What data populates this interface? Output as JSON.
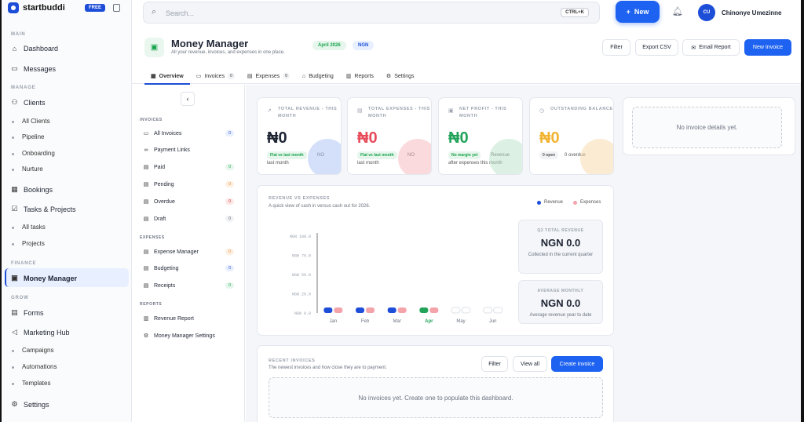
{
  "brand": {
    "name": "startbuddi",
    "plan_badge": "FREE"
  },
  "search": {
    "placeholder": "Search...",
    "shortcut": "CTRL+K"
  },
  "topbar": {
    "new_label": "New",
    "user_initials": "CU",
    "user_name": "Chinonye Umezinne"
  },
  "sidebar": {
    "sections": {
      "main": "MAIN",
      "manage": "MANAGE",
      "finance": "FINANCE",
      "grow": "GROW"
    },
    "items": {
      "dashboard": "Dashboard",
      "messages": "Messages",
      "clients": "Clients",
      "all_clients": "All Clients",
      "pipeline": "Pipeline",
      "onboarding": "Onboarding",
      "nurture": "Nurture",
      "bookings": "Bookings",
      "tasks_projects": "Tasks & Projects",
      "all_tasks": "All tasks",
      "projects": "Projects",
      "money_manager": "Money Manager",
      "forms": "Forms",
      "marketing_hub": "Marketing Hub",
      "campaigns": "Campaigns",
      "automations": "Automations",
      "templates": "Templates",
      "settings": "Settings"
    }
  },
  "header": {
    "title": "Money Manager",
    "subtitle": "All your revenue, invoices, and expenses in one place.",
    "month_badge": "April 2026",
    "currency_badge": "NGN",
    "buttons": {
      "filter": "Filter",
      "export": "Export CSV",
      "email": "Email Report",
      "new_invoice": "New Invoice"
    },
    "tabs": [
      {
        "label": "Overview"
      },
      {
        "label": "Invoices",
        "count": "0"
      },
      {
        "label": "Expenses",
        "count": "0"
      },
      {
        "label": "Budgeting"
      },
      {
        "label": "Reports"
      },
      {
        "label": "Settings"
      }
    ]
  },
  "subnav": {
    "sections": {
      "invoices": "INVOICES",
      "expenses": "EXPENSES",
      "reports": "REPORTS"
    },
    "items": {
      "all_invoices": {
        "label": "All Invoices",
        "count": "0"
      },
      "payment_links": {
        "label": "Payment Links"
      },
      "paid": {
        "label": "Paid",
        "count": "0"
      },
      "pending": {
        "label": "Pending",
        "count": "0"
      },
      "overdue": {
        "label": "Overdue",
        "count": "0"
      },
      "draft": {
        "label": "Draft",
        "count": "0"
      },
      "expense_manager": {
        "label": "Expense Manager",
        "count": "0"
      },
      "budgeting": {
        "label": "Budgeting",
        "count": "0"
      },
      "receipts": {
        "label": "Receipts",
        "count": "0"
      },
      "revenue_report": {
        "label": "Revenue Report"
      },
      "mm_settings": {
        "label": "Money Manager Settings"
      }
    }
  },
  "kpis": {
    "revenue": {
      "label": "TOTAL REVENUE - THIS MONTH",
      "value": "₦0",
      "chip": "Flat vs last month",
      "chip_extra": "NO",
      "sub": "last month"
    },
    "expenses": {
      "label": "TOTAL EXPENSES - THIS MONTH",
      "value": "₦0",
      "chip": "Flat vs last month",
      "chip_extra": "NO",
      "sub": "last month"
    },
    "profit": {
      "label": "NET PROFIT - THIS MONTH",
      "value": "₦0",
      "chip": "No margin yet",
      "chip_extra": "Revenue",
      "sub": "after expenses this month"
    },
    "balance": {
      "label": "OUTSTANDING BALANCE",
      "value": "₦0",
      "chip": "0 open",
      "chip_extra": "0 overdue"
    }
  },
  "invoice_details": {
    "empty": "No invoice details yet."
  },
  "chart_card": {
    "title": "REVENUE VS EXPENSES",
    "subtitle": "A quick view of cash in versus cash out for 2026.",
    "q2": {
      "title": "Q2 TOTAL REVENUE",
      "value": "NGN 0.0",
      "desc": "Collected in the current quarter"
    },
    "avg": {
      "title": "AVERAGE MONTHLY",
      "value": "NGN 0.0",
      "desc": "Average revenue year to date"
    }
  },
  "chart_data": {
    "type": "bar",
    "categories": [
      "Jan",
      "Feb",
      "Mar",
      "Apr",
      "May",
      "Jun"
    ],
    "series": [
      {
        "name": "Revenue",
        "values": [
          0,
          0,
          0,
          0,
          0,
          0
        ]
      },
      {
        "name": "Expenses",
        "values": [
          0,
          0,
          0,
          0,
          0,
          0
        ]
      }
    ],
    "y_ticks": [
      "NGN 100.0",
      "NGN 75.0",
      "NGN 50.0",
      "NGN 25.0",
      "NGN 0.0"
    ],
    "ylim": [
      0,
      100
    ],
    "highlight_category": "Apr",
    "colors": {
      "revenue": "#1d4ed8",
      "expenses": "#f4a3ab",
      "current": "#22a35a",
      "future": "#d4d8df"
    }
  },
  "recent": {
    "title": "RECENT INVOICES",
    "subtitle": "The newest invoices and how close they are to payment.",
    "filter": "Filter",
    "view_all": "View all",
    "create": "Create invoice",
    "empty": "No invoices yet. Create one to populate this dashboard."
  }
}
